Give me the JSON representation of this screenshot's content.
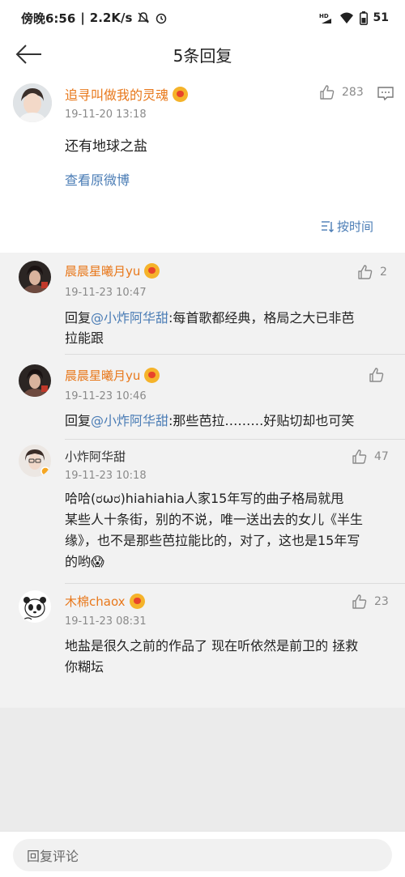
{
  "status_bar": {
    "time": "傍晚6:56",
    "speed": "2.2K/s",
    "battery": "51",
    "icons": [
      "mute-icon",
      "alarm-icon",
      "hd-icon",
      "signal-icon",
      "wifi-icon",
      "battery-icon"
    ]
  },
  "header": {
    "title": "5条回复",
    "back_icon": "arrow-left-icon"
  },
  "main_comment": {
    "username": "追寻叫做我的灵魂",
    "time": "19-11-20 13:18",
    "text": "还有地球之盐",
    "likes": "283",
    "link": "查看原微博",
    "sort": "按时间"
  },
  "replies": [
    {
      "username": "晨晨星曦月yu",
      "time": "19-11-23 10:47",
      "prefix": "回复",
      "at": "@小炸阿华甜",
      "text_line1": ":每首歌都经典，格局之大已非芭",
      "text_line2": "拉能跟",
      "likes": "2"
    },
    {
      "username": "晨晨星曦月yu",
      "time": "19-11-23 10:46",
      "prefix": "回复",
      "at": "@小炸阿华甜",
      "text_line1": ":那些芭拉………好贴切却也可笑",
      "likes": ""
    },
    {
      "username": "小炸阿华甜",
      "time": "19-11-23 10:18",
      "text_line1": "哈哈(ರωರ)hiahiahia人家15年写的曲子格局就甩",
      "text_line2": "某些人十条街，别的不说，唯一送出去的女儿《半生",
      "text_line3": "缘》，也不是那些芭拉能比的，对了，这也是15年写",
      "text_line4": "的哟😱",
      "likes": "47"
    },
    {
      "username": "木棉chaox",
      "time": "19-11-23 08:31",
      "text_line1": "地盐是很久之前的作品了 现在听依然是前卫的 拯救",
      "text_line2": "你糊坛",
      "likes": "23"
    }
  ],
  "bottom": {
    "placeholder": "回复评论"
  },
  "colors": {
    "username_orange": "#e8781b",
    "link_blue": "#4a7cb5",
    "meta_gray": "#8a8a8a",
    "background": "#f2f2f2"
  }
}
